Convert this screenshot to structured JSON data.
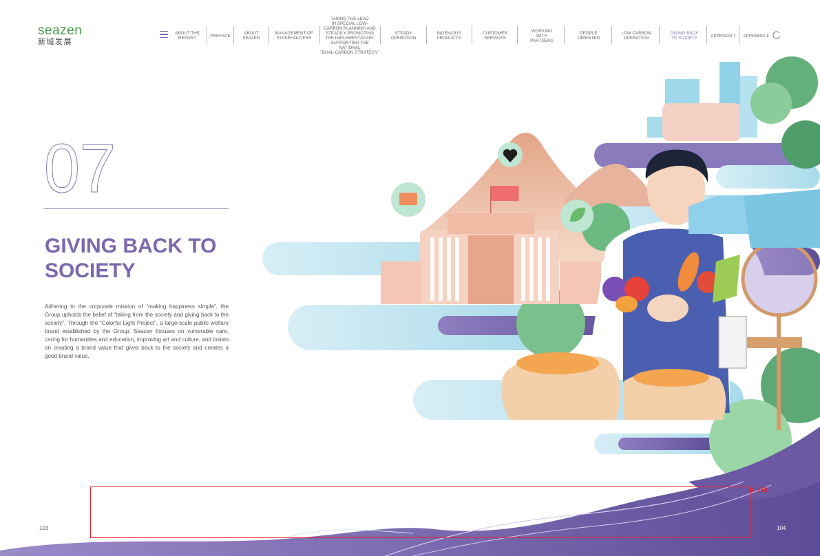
{
  "brand": {
    "name_en": "seazen",
    "name_cn": "新城发展"
  },
  "nav": {
    "items": [
      {
        "label": "ABOUT THE\nREPORT"
      },
      {
        "label": "PREFACE"
      },
      {
        "label": "ABOUT\nSEAZEN"
      },
      {
        "label": "MANAGEMENT OF\nSTAKEHOLDERS"
      },
      {
        "label": "TAKING THE LEAD\nIN SPECIAL LOW-\nCARBON PLANNING AND\nSTEADILY PROMOTING\nTHE IMPLEMENTATION:\nSUPPORTING THE NATIONAL\n\"DUAL-CARBON STRATEGY\""
      },
      {
        "label": "STEADY\nOPERATION"
      },
      {
        "label": "INGENIOUS\nPRODUCTS"
      },
      {
        "label": "CUSTOMER\nSERVICES"
      },
      {
        "label": "WORKING\nWITH\nPARTNERS"
      },
      {
        "label": "PEOPLE\nORIENTED"
      },
      {
        "label": "LOW CARBON\nOPERATION"
      },
      {
        "label": "GIVING BACK\nTO SOCIETY",
        "active": true
      },
      {
        "label": "APPENDIX Ⅰ"
      },
      {
        "label": "APPENDIX Ⅱ"
      }
    ],
    "menu_icon": "hamburger-menu-icon",
    "refresh_icon": "refresh-icon",
    "active_color": "#8574b9"
  },
  "chapter": {
    "number": "07",
    "title": "GIVING BACK TO\nSOCIETY",
    "body": "Adhering to the corporate mission of “making happiness simple”, the Group upholds the belief of “taking from the society and giving back to the society”. Through the “Colorful Light Project”, a large-scale public welfare brand established by the Group, Seazen focuses on vulnerable care, caring for humanities and education, improving art and culture, and insists on creating a brand value that gives back to the society and creates a good brand value.",
    "accent_color": "#7b68ae"
  },
  "pages": {
    "left": "103",
    "right": "104"
  },
  "annotation": {
    "label": "b_555",
    "color": "#e0242b"
  }
}
